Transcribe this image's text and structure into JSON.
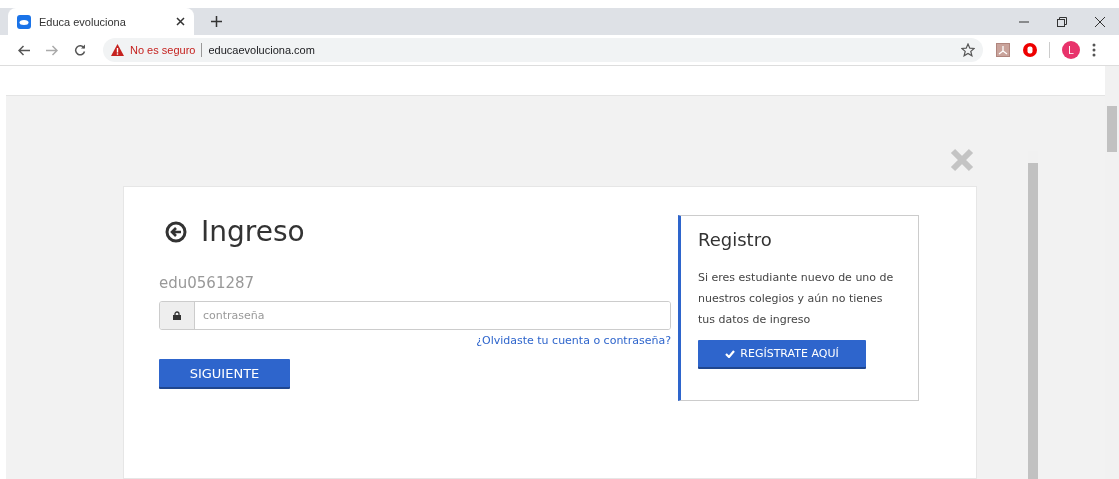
{
  "browser": {
    "tab": {
      "title": "Educa evoluciona",
      "selected": true
    },
    "security": "No es seguro",
    "url": "educaevoluciona.com",
    "avatar": "L"
  },
  "login": {
    "title": "Ingreso",
    "username": "edu0561287",
    "password": {
      "placeholder": "contraseña"
    },
    "forgot_link": "¿Olvidaste tu cuenta o contraseña?",
    "next_button": "SIGUIENTE"
  },
  "register": {
    "title": "Registro",
    "text": "Si eres estudiante nuevo de uno de nuestros colegios y aún no tienes tus datos de ingreso",
    "button": "REGÍSTRATE AQUÍ"
  }
}
